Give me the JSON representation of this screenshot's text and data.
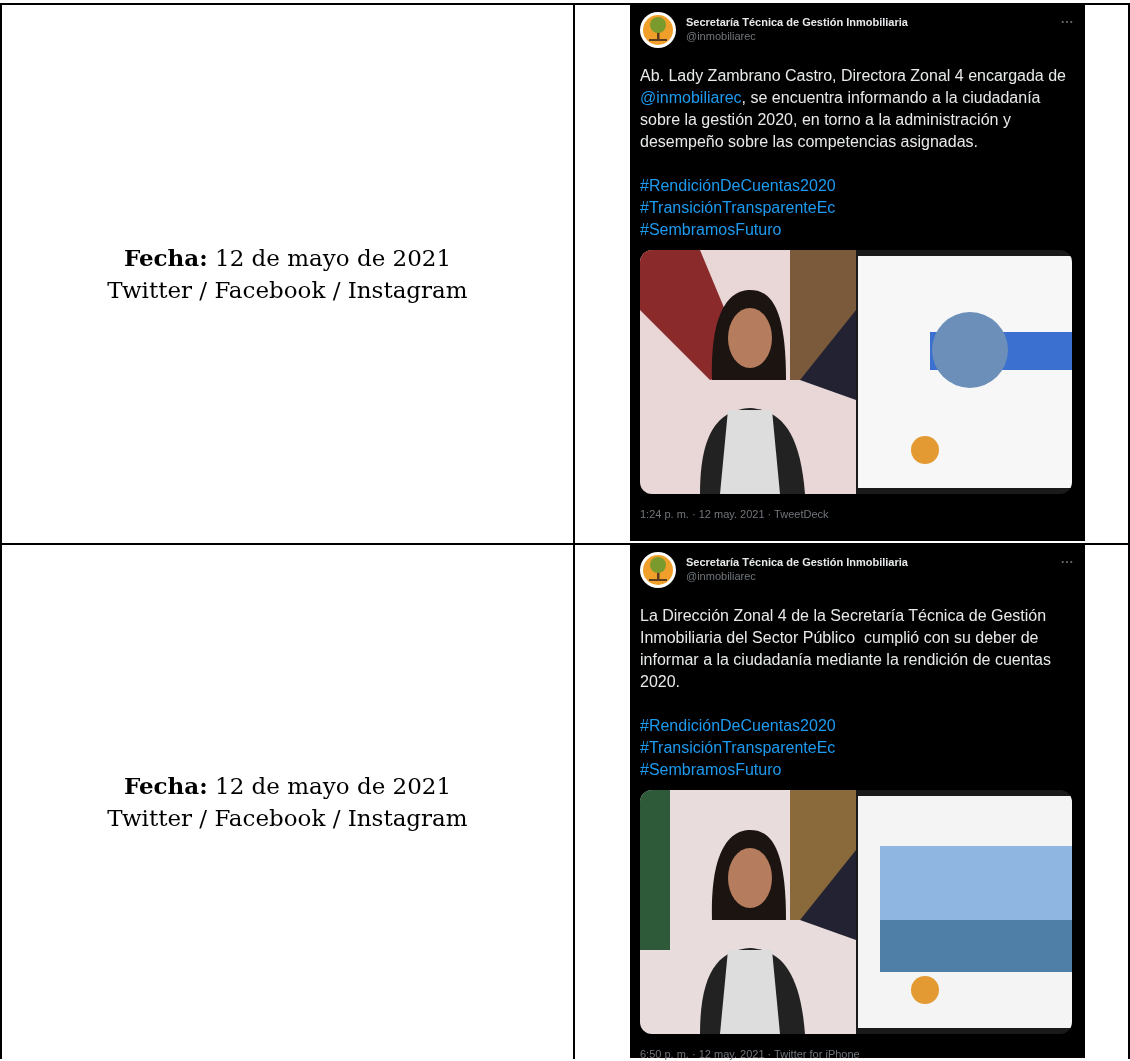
{
  "rows": [
    {
      "date_label": "Fecha:",
      "date": "12 de mayo de 2021",
      "networks": "Twitter / Facebook / Instagram",
      "tweet": {
        "account_name": "Secretaría Técnica de Gestión Inmobiliaria",
        "handle": "@inmobiliarec",
        "body": [
          {
            "kind": "text",
            "text": "Ab. Lady Zambrano Castro, Directora Zonal 4 encargada de "
          },
          {
            "kind": "mention",
            "text": "@inmobiliarec"
          },
          {
            "kind": "text",
            "text": ", se encuentra informando a la ciudadanía sobre la gestión 2020, en torno a la administración y desempeño sobre las competencias asignadas."
          }
        ],
        "hashtags": [
          "#RendiciónDeCuentas2020",
          "#TransiciónTransparenteEc",
          "#SembramosFuturo"
        ],
        "meta": "1:24 p. m. · 12 may. 2021 · TweetDeck"
      }
    },
    {
      "date_label": "Fecha:",
      "date": "12 de mayo de 2021",
      "networks": "Twitter / Facebook / Instagram",
      "tweet": {
        "account_name": "Secretaría Técnica de Gestión Inmobiliaria",
        "handle": "@inmobiliarec",
        "body": [
          {
            "kind": "text",
            "text": "La Dirección Zonal 4 de la Secretaría Técnica de Gestión Inmobiliaria del Sector Público  cumplió con su deber de informar a la ciudadanía mediante la rendición de cuentas 2020."
          }
        ],
        "hashtags": [
          "#RendiciónDeCuentas2020",
          "#TransiciónTransparenteEc",
          "#SembramosFuturo"
        ],
        "meta": "6:50 p. m. · 12 may. 2021 · Twitter for iPhone"
      }
    }
  ]
}
